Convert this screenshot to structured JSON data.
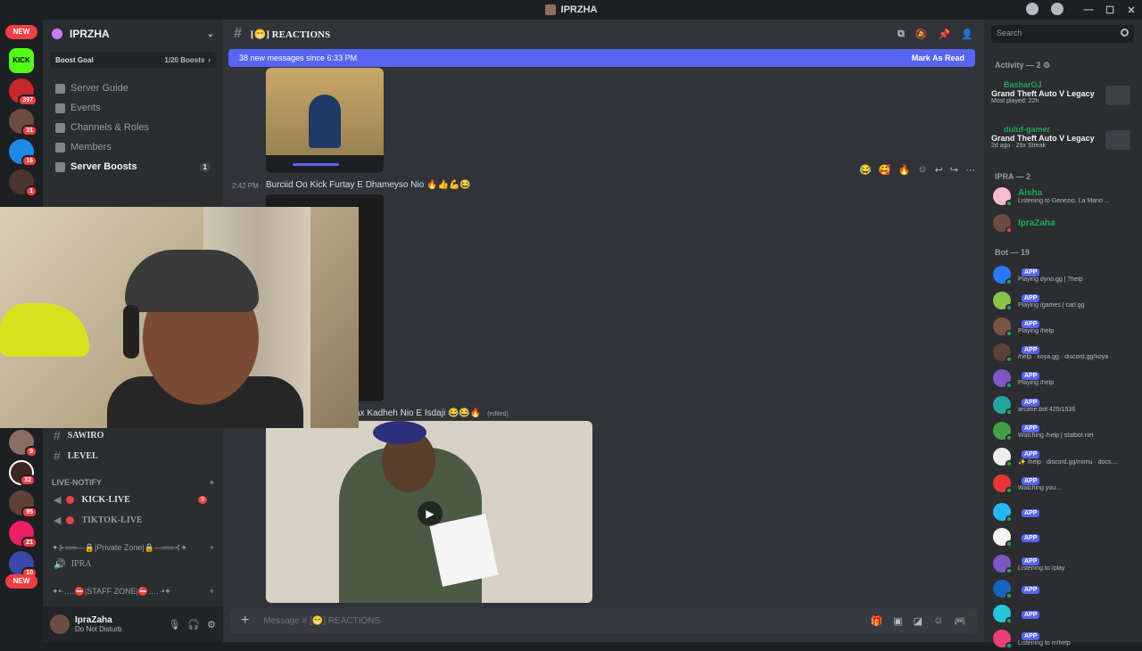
{
  "window": {
    "title": "IPRZHA"
  },
  "rail": {
    "new_label": "NEW",
    "kick_label": "KICK",
    "badges": [
      "397",
      "31",
      "16",
      "1",
      "9",
      "32",
      "95",
      "21",
      "10"
    ],
    "new_bottom_label": "NEW"
  },
  "sidebar": {
    "guild_name": "IPRZHA",
    "boost_goal_label": "Boost Goal",
    "boost_count": "1/20 Boosts",
    "nav": [
      {
        "label": "Server Guide"
      },
      {
        "label": "Events"
      },
      {
        "label": "Channels & Roles"
      },
      {
        "label": "Members"
      },
      {
        "label": "Server Boosts",
        "badge": "1"
      }
    ],
    "channels": {
      "sawiro": "SAWIRO",
      "level": "LEVEL",
      "live_notify_category": "LIVE-NOTIFY",
      "kick_live": "KICK-LIVE",
      "kick_live_badge": "9",
      "tiktok_live": "TIKTOK-LIVE",
      "private_zone_category": "✦⊱══—🔒|Private Zone|🔒—══⊰✦",
      "ipra": "IPRA",
      "staff_zone_category": "✦•·‥‥⛔|STAFF ZONE|⛔‥‥·•✦"
    },
    "user": {
      "name": "IpraZaha",
      "status": "Do Not Disturb"
    }
  },
  "main": {
    "channel_name": "[😁] REACTIONS",
    "new_messages": "38 new messages since 6:33 PM",
    "mark_as_read": "Mark As Read",
    "msg1_time": "2:42 PM",
    "msg1_text": "Burciid Oo Kick Furtay E Dhameyso Nio 🔥👍💪😂",
    "msg2_text": "ax Kadheh Nio E Isdaji 😂😂🔥",
    "msg2_edited": "(edited)",
    "composer_placeholder": "Message # [😁] REACTIONS",
    "reactions": [
      "😂",
      "🥰",
      "🔥"
    ]
  },
  "members": {
    "search_placeholder": "Search",
    "activity_header": "Activity — 2",
    "activities": [
      {
        "user": "BasharOJ",
        "game": "Grand Theft Auto V Legacy",
        "sub": "Most played: 22h"
      },
      {
        "user": "duluf-gamer",
        "game": "Grand Theft Auto V Legacy",
        "sub": "2d ago · 29x Streak"
      }
    ],
    "ipra_header": "IPRA — 2",
    "ipra_members": [
      {
        "name": "Aisha",
        "sub": "Listening to Genezio, La Mano ..."
      },
      {
        "name": "IpraZaha",
        "sub": ""
      }
    ],
    "bot_header": "Bot — 19",
    "app_label": "APP",
    "bots": [
      {
        "sub": "Playing dyno.gg | ?help"
      },
      {
        "sub": "Playing /games | carl.gg"
      },
      {
        "sub": "Playing /help"
      },
      {
        "sub": "/help · koya.gg · discord.gg/koya"
      },
      {
        "sub": "Playing /help"
      },
      {
        "sub": "arcane.bot 425/1536"
      },
      {
        "sub": "Watching /help | statbot.net"
      },
      {
        "sub": "✨ /help · discord.gg/mimu · docs...."
      },
      {
        "sub": "Watching you..."
      },
      {
        "sub": ""
      },
      {
        "sub": ""
      },
      {
        "sub": "Listening to /play"
      },
      {
        "sub": ""
      },
      {
        "sub": ""
      },
      {
        "sub": "Listening to m!help"
      }
    ]
  }
}
